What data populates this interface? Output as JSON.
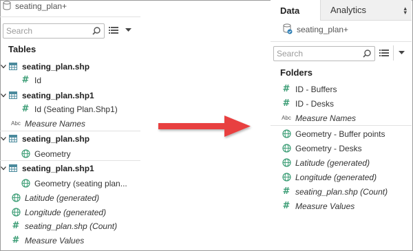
{
  "left_pane": {
    "datasource_name": "seating_plan+",
    "search_placeholder": "Search",
    "tables_heading": "Tables",
    "items": [
      {
        "kind": "table",
        "label": "seating_plan.shp",
        "icon": "table-icon"
      },
      {
        "kind": "measure",
        "label": "Id",
        "icon": "hash-icon"
      },
      {
        "kind": "table",
        "label": "seating_plan.shp1",
        "icon": "table-icon"
      },
      {
        "kind": "measure",
        "label": "Id (Seating Plan.Shp1)",
        "icon": "hash-icon"
      },
      {
        "kind": "dimension",
        "label": "Measure Names",
        "icon": "abc-icon"
      },
      {
        "kind": "table",
        "label": "seating_plan.shp",
        "icon": "table-icon"
      },
      {
        "kind": "geo",
        "label": "Geometry",
        "icon": "globe-icon"
      },
      {
        "kind": "table",
        "label": "seating_plan.shp1",
        "icon": "table-icon"
      },
      {
        "kind": "geo",
        "label": "Geometry (seating plan...",
        "icon": "globe-icon"
      },
      {
        "kind": "geo",
        "label": "Latitude (generated)",
        "icon": "globe-icon"
      },
      {
        "kind": "geo",
        "label": "Longitude (generated)",
        "icon": "globe-icon"
      },
      {
        "kind": "measure",
        "label": "seating_plan.shp (Count)",
        "icon": "hash-icon"
      },
      {
        "kind": "measure",
        "label": "Measure Values",
        "icon": "hash-icon"
      }
    ]
  },
  "right_pane": {
    "tabs": [
      {
        "label": "Data"
      },
      {
        "label": "Analytics"
      }
    ],
    "datasource_name": "seating_plan+",
    "search_placeholder": "Search",
    "folders_heading": "Folders",
    "items": [
      {
        "kind": "measure",
        "label": "ID - Buffers",
        "icon": "hash-icon"
      },
      {
        "kind": "measure",
        "label": "ID - Desks",
        "icon": "hash-icon"
      },
      {
        "kind": "dimension",
        "label": "Measure Names",
        "icon": "abc-icon"
      },
      {
        "kind": "geo",
        "label": "Geometry - Buffer points",
        "icon": "globe-icon"
      },
      {
        "kind": "geo",
        "label": "Geometry - Desks",
        "icon": "globe-icon"
      },
      {
        "kind": "geo",
        "label": "Latitude (generated)",
        "icon": "globe-icon"
      },
      {
        "kind": "geo",
        "label": "Longitude (generated)",
        "icon": "globe-icon"
      },
      {
        "kind": "measure",
        "label": "seating_plan.shp (Count)",
        "icon": "hash-icon"
      },
      {
        "kind": "measure",
        "label": "Measure Values",
        "icon": "hash-icon"
      }
    ]
  },
  "colors": {
    "measure_green": "#3a9c74",
    "table_teal": "#4a8a9c",
    "arrow_red": "#e8403f"
  }
}
